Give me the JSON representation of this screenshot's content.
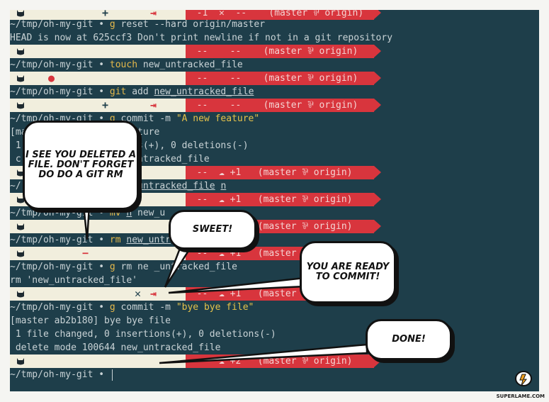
{
  "terminal": {
    "lines": [
      {
        "id": "l1",
        "text": "~/tmp/oh-my-git • ",
        "cmd": "g",
        "rest": " reset --hard origin/master"
      },
      {
        "id": "l2",
        "plain": "HEAD is now at 625ccf3 Don't print newline if not in a git repository"
      },
      {
        "id": "l3",
        "text": "~/tmp/oh-my-git • ",
        "cmd": "touch",
        "rest": " new_untracked_file"
      },
      {
        "id": "l4",
        "text": "~/tmp/oh-my-git • ",
        "cmd": "git",
        "rest": " add ",
        "und": "new_untracked_file"
      },
      {
        "id": "l5",
        "text": "~/tmp/oh-my-git • ",
        "cmd": "g",
        "rest": " commit -m ",
        "str": "\"A new feature\""
      },
      {
        "id": "l6",
        "plain": "[ma                 feature"
      },
      {
        "id": "l7",
        "plain": " 1               ertions(+), 0 deletions(-)"
      },
      {
        "id": "l8",
        "plain": " c                new_untracked_file"
      },
      {
        "id": "l9",
        "text": "~/                 ",
        "und": "new_untracked_file",
        "rest2": " ",
        "und2": "n"
      },
      {
        "id": "l10",
        "text": "~/tmp/oh-my-git • ",
        "cmd": "mv",
        "rest": " ",
        "und": "n",
        "rest2": " new_u"
      },
      {
        "id": "l11",
        "text": "~/tmp/oh-my-git • ",
        "cmd": "rm",
        "rest": " ",
        "und": "new_untr"
      },
      {
        "id": "l12",
        "text": "~/tmp/oh-my-git • ",
        "cmd": "g",
        "rest": " rm ne",
        "rest2": " _untracked_file"
      },
      {
        "id": "l13",
        "plain": "rm 'new_untracked_file'"
      },
      {
        "id": "l14",
        "text": "~/tmp/oh-my-git • ",
        "cmd": "g",
        "rest": " commit -m ",
        "str": "\"bye bye file\""
      },
      {
        "id": "l15",
        "plain": "[master ab2b180] bye bye file"
      },
      {
        "id": "l16",
        "plain": " 1 file changed, 0 insertions(+), 0 deletions(-)"
      },
      {
        "id": "l17",
        "plain": " delete mode 100644 new_untracked_file"
      },
      {
        "id": "l18",
        "text": "~/tmp/oh-my-git • "
      }
    ],
    "prompts": [
      {
        "id": "p0",
        "right": "  -1  ✕  --    (master ⅌ origin)"
      },
      {
        "id": "p1",
        "right": "  --    --    (master ⅌ origin)"
      },
      {
        "id": "p2",
        "right": "  --    --    (master ⅌ origin)"
      },
      {
        "id": "p3",
        "right": "  --    --    (master ⅌ origin)"
      },
      {
        "id": "p4",
        "right": "  --  ☁ +1   (master ⅌ origin)"
      },
      {
        "id": "p5",
        "right": "  --  ☁ +1   (master ⅌ origin)"
      },
      {
        "id": "p6",
        "right": "  --  ☁ +1   (master ⅌ origin)"
      },
      {
        "id": "p7",
        "right": "  --  ☁ +1   (master ⅌ origin)"
      },
      {
        "id": "p8",
        "right": "  --  ☁ +1   (master ⅌ origin)"
      },
      {
        "id": "p9",
        "right": "  --  ☁ +2   (master ⅌ origin)"
      }
    ]
  },
  "bubbles": {
    "b1": "I see you deleted a file. Don't forget do do a git rm",
    "b2": "Sweet!",
    "b3": "You are ready to commit!",
    "b4": "Done!"
  },
  "watermark": "SUPERLAME.COM",
  "colors": {
    "terminal_bg": "#1e3e4a",
    "prompt_left": "#f1eedd",
    "prompt_right": "#d8353d",
    "command": "#e5b94a"
  }
}
